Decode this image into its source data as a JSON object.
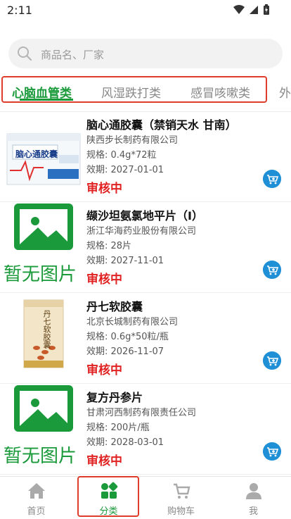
{
  "status_bar": {
    "time": "2:11"
  },
  "search": {
    "placeholder": "商品名、厂家"
  },
  "tabs": [
    {
      "label": "心脑血管类",
      "active": true
    },
    {
      "label": "风湿跌打类",
      "active": false
    },
    {
      "label": "感冒咳嗽类",
      "active": false
    },
    {
      "label": "外",
      "active": false
    }
  ],
  "products": [
    {
      "name": "脑心通胶囊（禁销天水 甘南）",
      "manufacturer": "陕西步长制药有限公司",
      "spec": "规格: 0.4g*72粒",
      "expiry": "效期: 2027-01-01",
      "status": "审核中",
      "package_text": "脑心通胶囊"
    },
    {
      "name": "缬沙坦氨氯地平片（I）",
      "manufacturer": "浙江华海药业股份有限公司",
      "spec": "规格: 28片",
      "expiry": "效期: 2027-11-01",
      "status": "审核中",
      "no_image_text": "暂无图片"
    },
    {
      "name": "丹七软胶囊",
      "manufacturer": "北京长城制药有限公司",
      "spec": "规格: 0.6g*50粒/瓶",
      "expiry": "效期: 2026-11-07",
      "status": "审核中",
      "package_text": "丹七软胶囊"
    },
    {
      "name": "复方丹参片",
      "manufacturer": "甘肃河西制药有限责任公司",
      "spec": "规格: 200片/瓶",
      "expiry": "效期: 2028-03-01",
      "status": "审核中",
      "no_image_text": "暂无图片"
    }
  ],
  "bottom_nav": [
    {
      "label": "首页",
      "icon": "home-icon",
      "active": false
    },
    {
      "label": "分类",
      "icon": "category-icon",
      "active": true
    },
    {
      "label": "购物车",
      "icon": "cart-icon",
      "active": false
    },
    {
      "label": "我",
      "icon": "user-icon",
      "active": false
    }
  ],
  "colors": {
    "accent_green": "#1a9a3a",
    "status_red": "#e02222",
    "cart_blue": "#1f8fd6"
  }
}
